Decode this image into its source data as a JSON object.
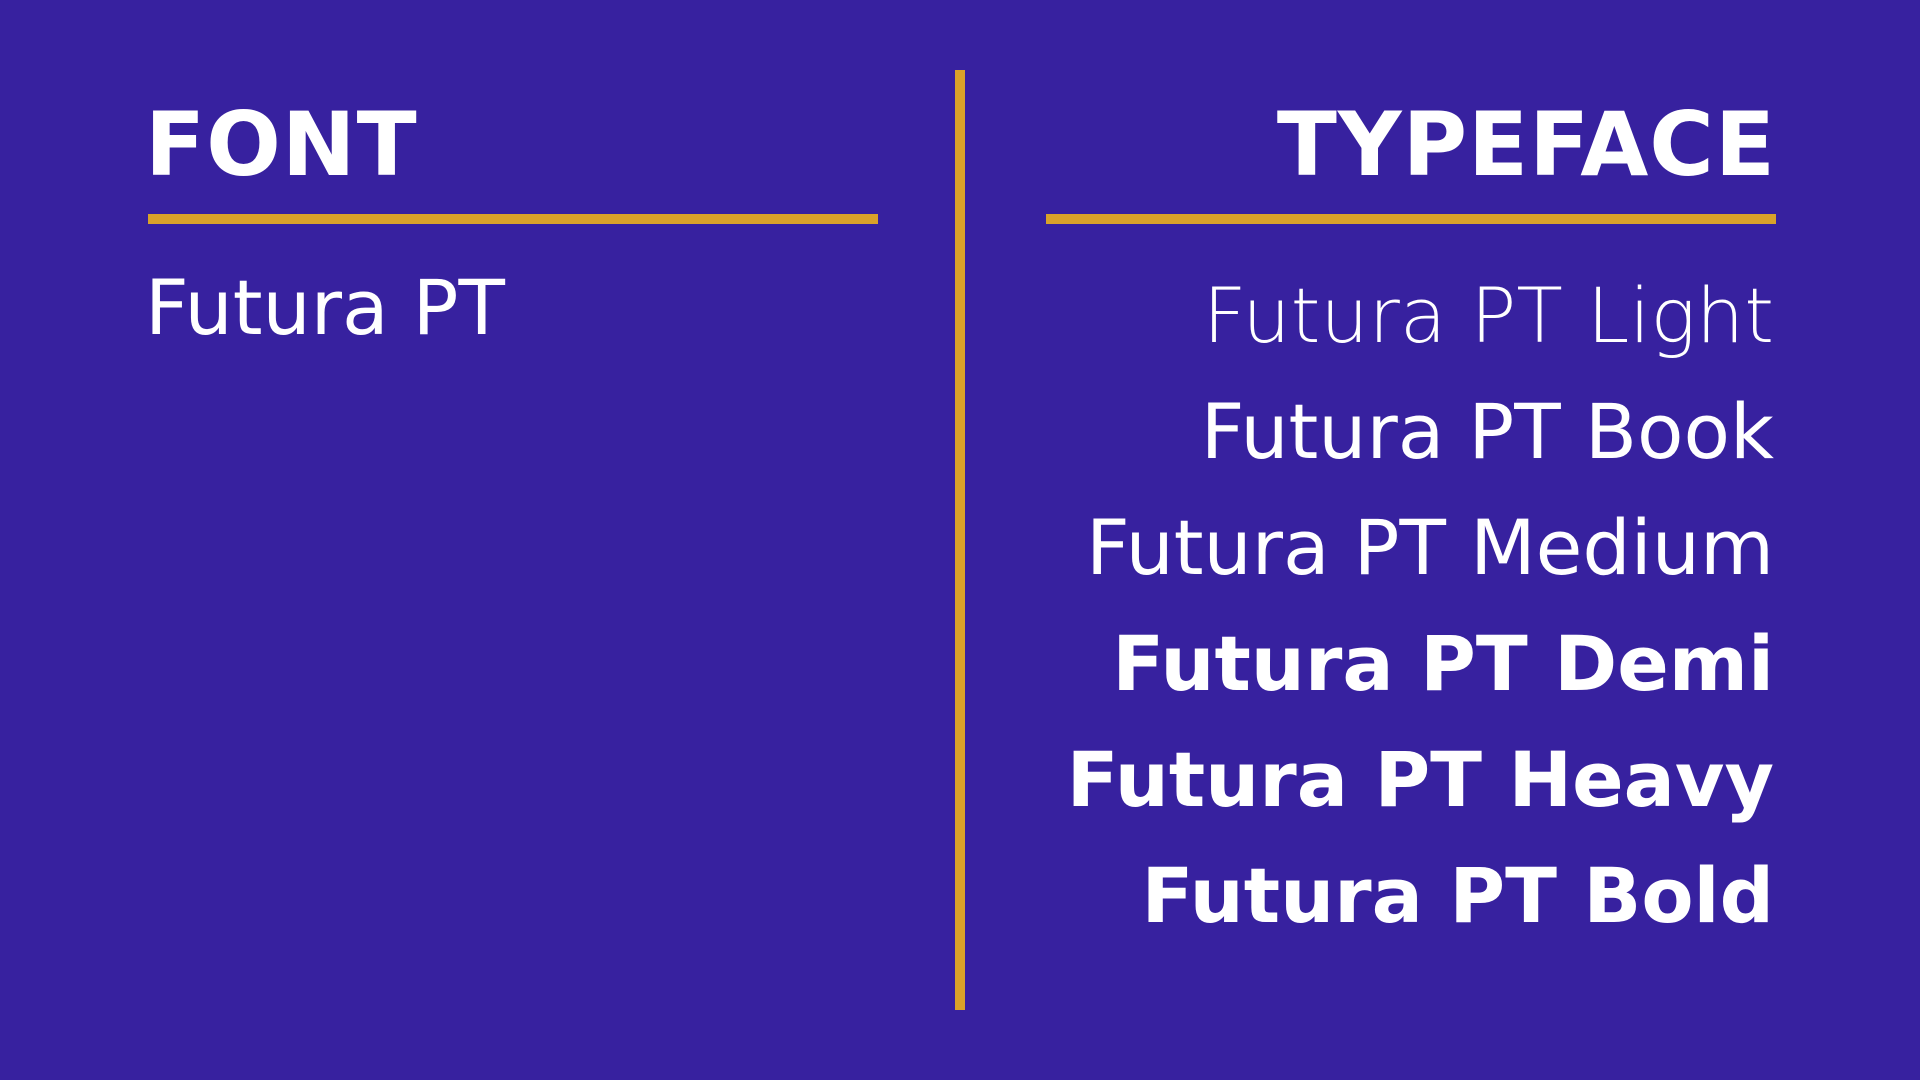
{
  "colors": {
    "background": "#37219f",
    "accent": "#d9a22a",
    "text": "#ffffff"
  },
  "left": {
    "heading": "FONT",
    "items": [
      "Futura PT"
    ]
  },
  "right": {
    "heading": "TYPEFACE",
    "items": [
      "Futura PT Light",
      "Futura PT Book",
      "Futura PT Medium",
      "Futura PT Demi",
      "Futura PT Heavy",
      "Futura PT Bold"
    ]
  }
}
